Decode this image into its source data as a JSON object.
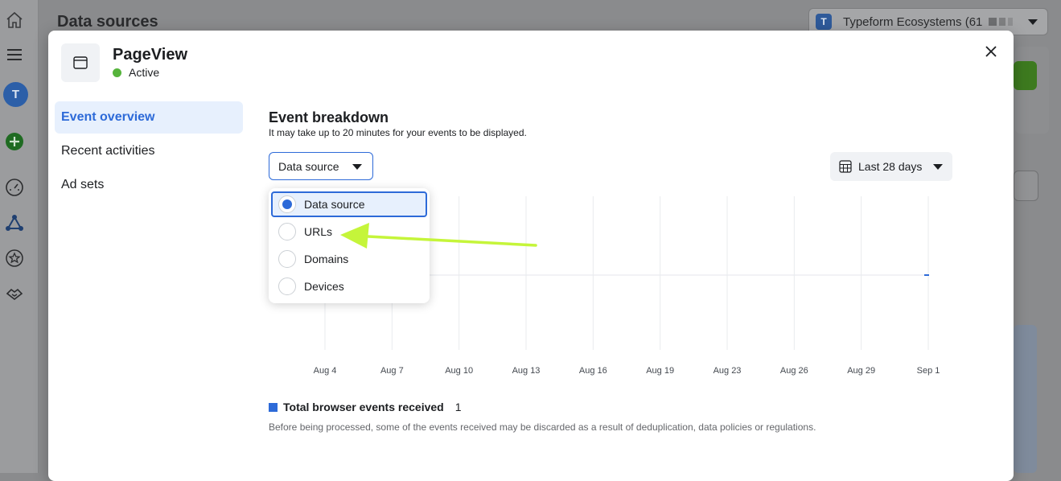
{
  "background": {
    "page_title": "Data sources",
    "account": {
      "badge": "T",
      "name": "Typeform Ecosystems (61"
    },
    "rail_avatar": "T"
  },
  "modal": {
    "event_name": "PageView",
    "status": "Active",
    "nav": [
      {
        "label": "Event overview",
        "active": true
      },
      {
        "label": "Recent activities",
        "active": false
      },
      {
        "label": "Ad sets",
        "active": false
      }
    ],
    "section_title": "Event breakdown",
    "section_subtitle": "It may take up to 20 minutes for your events to be displayed.",
    "breakdown_select": {
      "value": "Data source"
    },
    "date_range": {
      "label": "Last 28 days"
    },
    "dropdown_options": [
      {
        "label": "Data source",
        "selected": true
      },
      {
        "label": "URLs",
        "selected": false
      },
      {
        "label": "Domains",
        "selected": false
      },
      {
        "label": "Devices",
        "selected": false
      }
    ],
    "legend": {
      "label": "Total browser events received",
      "value": "1"
    },
    "footnote": "Before being processed, some of the events received may be discarded as a result of deduplication, data policies or regulations."
  },
  "chart_data": {
    "type": "line",
    "title": "",
    "xlabel": "",
    "ylabel": "",
    "categories": [
      "Aug 4",
      "Aug 7",
      "Aug 10",
      "Aug 13",
      "Aug 16",
      "Aug 19",
      "Aug 23",
      "Aug 26",
      "Aug 29",
      "Sep 1"
    ],
    "series": [
      {
        "name": "Total browser events received",
        "color": "#2d6ad8",
        "points": [
          {
            "x": "Sep 1",
            "y": 1
          }
        ]
      }
    ],
    "grid": true
  },
  "colors": {
    "accent": "#2d6ad8",
    "active_green": "#56b43c",
    "arrow_annotation": "#c5f53a"
  }
}
